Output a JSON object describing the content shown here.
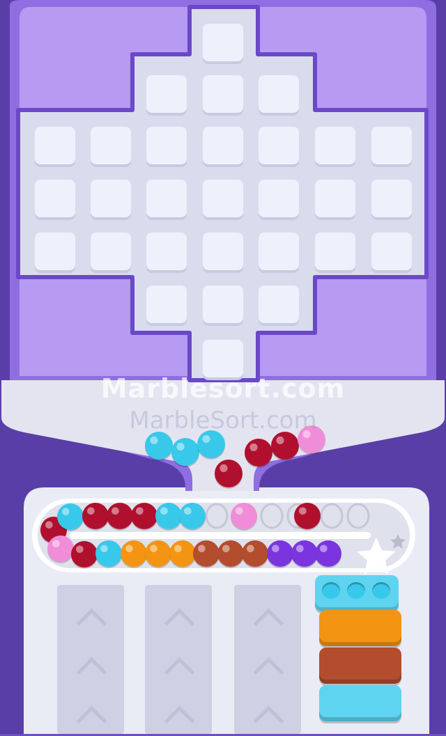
{
  "watermark": {
    "primary": "Marblesort.com",
    "secondary": "MarbleSort.com"
  },
  "colors": {
    "background": "#6d4fc0",
    "board_frame": "#8e6ee0",
    "board_top": "#bd9ef5",
    "grid_floor": "#d9dcec",
    "tile": "#eef0fb",
    "track": "#e7e9f3",
    "cyan": "#38c8ea",
    "maroon": "#b0102e",
    "pink": "#f08dd8",
    "orange": "#f39413",
    "brown": "#b44c2e",
    "purple": "#7b35df"
  },
  "board": {
    "shape": "cross",
    "rows": [
      {
        "columns": [
          3
        ]
      },
      {
        "columns": [
          2,
          3,
          4
        ]
      },
      {
        "columns": [
          0,
          1,
          2,
          3,
          4,
          5,
          6
        ]
      },
      {
        "columns": [
          0,
          1,
          2,
          3,
          4,
          5,
          6
        ]
      },
      {
        "columns": [
          0,
          1,
          2,
          3,
          4,
          5,
          6
        ]
      },
      {
        "columns": [
          2,
          3,
          4
        ]
      },
      {
        "columns": [
          3
        ]
      }
    ]
  },
  "falling_marbles": [
    "cyan",
    "cyan",
    "cyan",
    "maroon",
    "maroon",
    "maroon",
    "pink"
  ],
  "conveyor": {
    "top_lane": [
      "maroon",
      "cyan",
      "maroon",
      "maroon",
      "maroon",
      "cyan",
      "cyan",
      "empty",
      "pink",
      "empty",
      "empty",
      "maroon",
      "empty",
      "empty"
    ],
    "bottom_lane": [
      "pink",
      "maroon",
      "cyan",
      "orange",
      "orange",
      "orange",
      "brown",
      "brown",
      "brown",
      "purple",
      "purple",
      "purple"
    ]
  },
  "sort_trays": {
    "count": 3
  },
  "tube_stack": {
    "top_holes": [
      "cyan",
      "cyan",
      "cyan"
    ],
    "blocks": [
      "orange",
      "brown",
      "cyan"
    ]
  }
}
